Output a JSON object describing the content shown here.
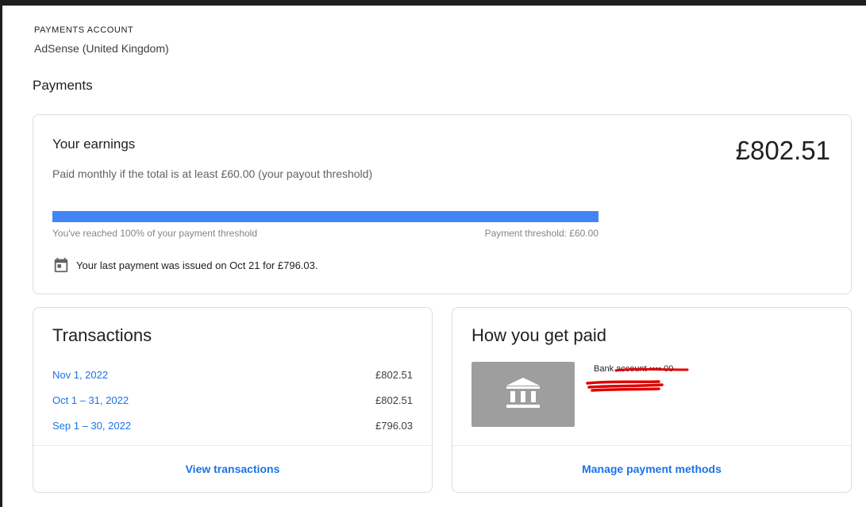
{
  "account": {
    "label": "PAYMENTS ACCOUNT",
    "name": "AdSense (United Kingdom)"
  },
  "page": {
    "title": "Payments"
  },
  "earnings": {
    "title": "Your earnings",
    "subtitle": "Paid monthly if the total is at least £60.00 (your payout threshold)",
    "amount": "£802.51",
    "progress_fraction": 1.0,
    "progress_left": "You've reached 100% of your payment threshold",
    "progress_right": "Payment threshold: £60.00",
    "last_payment_text": "Your last payment was issued on Oct 21 for £796.03.",
    "icon": "calendar-icon",
    "progress_color": "#4285f4"
  },
  "transactions": {
    "title": "Transactions",
    "rows": [
      {
        "date": "Nov 1, 2022",
        "amount": "£802.51"
      },
      {
        "date": "Oct 1 – 31, 2022",
        "amount": "£802.51"
      },
      {
        "date": "Sep 1 – 30, 2022",
        "amount": "£796.03"
      }
    ],
    "footer_link": "View transactions"
  },
  "payment_method": {
    "title": "How you get paid",
    "bank_label": "Bank account •••• 00",
    "icon": "bank-icon",
    "redaction_color": "#e00000",
    "footer_link": "Manage payment methods"
  },
  "colors": {
    "link": "#1a73e8",
    "border": "#dadce0"
  }
}
